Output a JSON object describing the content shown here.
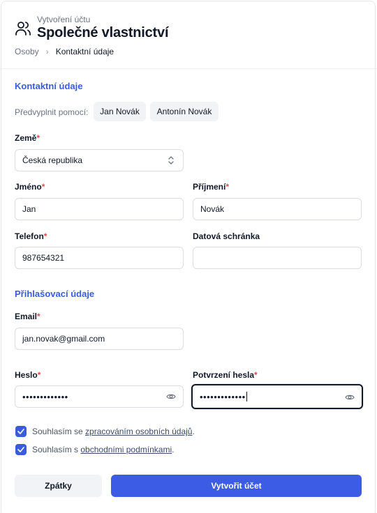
{
  "header": {
    "subtitle": "Vytvoření účtu",
    "title": "Společné vlastnictví"
  },
  "breadcrumb": {
    "parent": "Osoby",
    "separator": "›",
    "current": "Kontaktní údaje"
  },
  "contact_section": {
    "title": "Kontaktní údaje",
    "prefill_label": "Předvyplnit pomocí:",
    "prefill_options": [
      "Jan Novák",
      "Antonín Novák"
    ],
    "country": {
      "label": "Země",
      "value": "Česká republika"
    },
    "first_name": {
      "label": "Jméno",
      "value": "Jan"
    },
    "last_name": {
      "label": "Příjmení",
      "value": "Novák"
    },
    "phone": {
      "label": "Telefon",
      "value": "987654321"
    },
    "data_box": {
      "label": "Datová schránka",
      "value": ""
    }
  },
  "login_section": {
    "title": "Přihlašovací údaje",
    "email": {
      "label": "Email",
      "value": "jan.novak@gmail.com"
    },
    "password": {
      "label": "Heslo",
      "value": "•••••••••••••"
    },
    "password_confirm": {
      "label": "Potvrzení hesla",
      "value": "•••••••••••••"
    }
  },
  "consents": {
    "gdpr": {
      "prefix": "Souhlasím se ",
      "link": "zpracováním osobních údajů",
      "suffix": ".",
      "checked": true
    },
    "terms": {
      "prefix": "Souhlasím s ",
      "link": "obchodními podmínkami",
      "suffix": ".",
      "checked": true
    }
  },
  "actions": {
    "back_label": "Zpátky",
    "submit_label": "Vytvořit účet"
  },
  "required_mark": "*",
  "colors": {
    "accent": "#3d5ce5",
    "section_title": "#3b5bdb",
    "required": "#e5484d"
  }
}
